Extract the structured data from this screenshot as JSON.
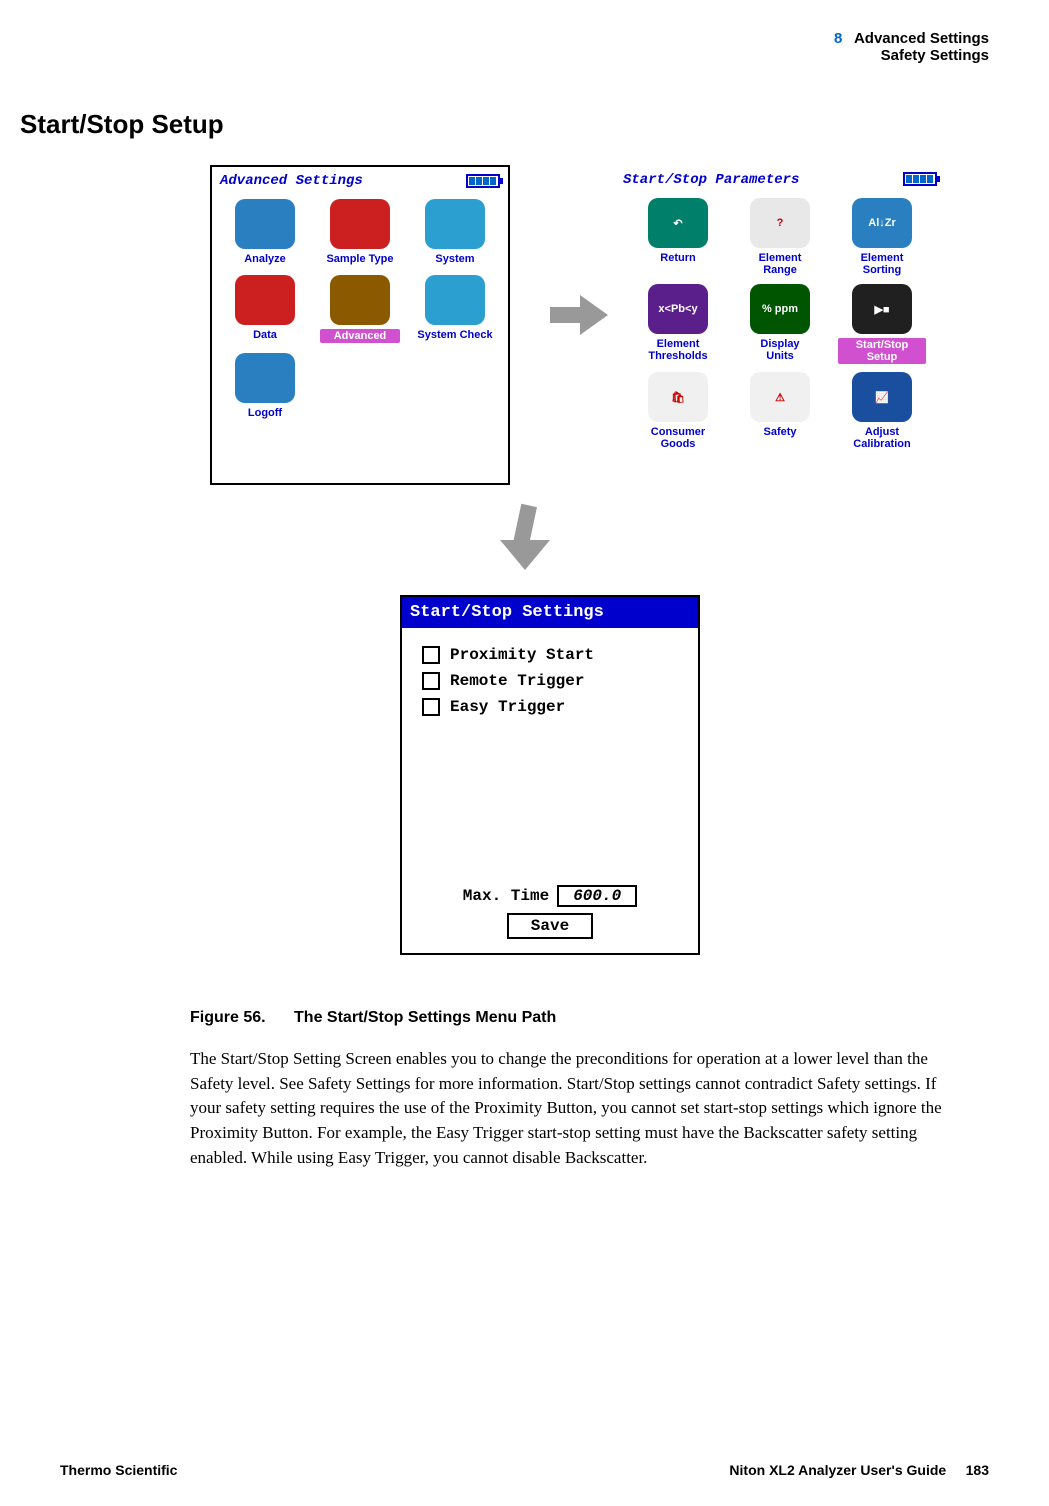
{
  "header": {
    "chapter_num": "8",
    "chapter_title": "Advanced Settings",
    "breadcrumb": "Safety Settings"
  },
  "section_heading": "Start/Stop Setup",
  "screen_advanced": {
    "title": "Advanced Settings",
    "items": [
      {
        "label": "Analyze",
        "color": "#2a7fc0"
      },
      {
        "label": "Sample Type",
        "color": "#cc2020"
      },
      {
        "label": "System",
        "color": "#2a9fd0"
      },
      {
        "label": "Data",
        "color": "#cc2020"
      },
      {
        "label": "Advanced",
        "color": "#8b5a00"
      },
      {
        "label": "System Check",
        "color": "#2a9fd0"
      },
      {
        "label": "Logoff",
        "color": "#2a7fc0"
      }
    ]
  },
  "screen_params": {
    "title": "Start/Stop Parameters",
    "items": [
      {
        "label": "Return",
        "color": "#00806a",
        "glyph": "↶"
      },
      {
        "label": "Element Range",
        "color": "#e8e8e8",
        "glyph": "?"
      },
      {
        "label": "Element Sorting",
        "color": "#2a7fc0",
        "glyph": "Al↓Zr"
      },
      {
        "label": "Element Thresholds",
        "color": "#5a1f8a",
        "glyph": "x<Pb<y"
      },
      {
        "label": "Display Units",
        "color": "#005500",
        "glyph": "% ppm"
      },
      {
        "label": "Start/Stop Setup",
        "color": "#202020",
        "glyph": "▶■",
        "selected": true
      },
      {
        "label": "Consumer Goods",
        "color": "#f0f0f0",
        "glyph": "🛍"
      },
      {
        "label": "Safety",
        "color": "#f0f0f0",
        "glyph": "⚠"
      },
      {
        "label": "Adjust Calibration",
        "color": "#1a4fa0",
        "glyph": "📈"
      }
    ]
  },
  "screen_settings": {
    "title": "Start/Stop Settings",
    "options": [
      "Proximity Start",
      "Remote Trigger",
      "Easy Trigger"
    ],
    "max_time_label": "Max. Time",
    "max_time_value": "600.0",
    "save_label": "Save"
  },
  "figure": {
    "number": "Figure 56.",
    "caption": "The Start/Stop Settings Menu Path"
  },
  "body_paragraph": "The Start/Stop Setting Screen enables you to change the preconditions for operation at a lower level than the Safety level. See Safety Settings for more information. Start/Stop settings cannot contradict Safety settings. If your safety setting requires the use of the Proximity Button, you cannot set start-stop settings which ignore the Proximity Button. For example, the Easy Trigger start-stop setting must have the Backscatter safety setting enabled. While using Easy Trigger, you cannot disable Backscatter.",
  "footer": {
    "left": "Thermo Scientific",
    "right_guide": "Niton XL2 Analyzer User's Guide",
    "page_num": "183"
  }
}
